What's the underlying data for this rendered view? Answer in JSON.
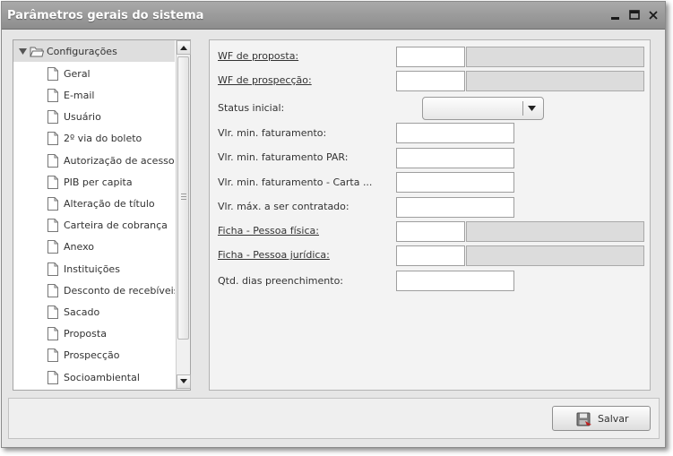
{
  "window": {
    "title": "Parâmetros gerais do sistema",
    "controls": {
      "minimize_icon": "minimize-icon",
      "maximize_icon": "maximize-icon",
      "close_icon": "close-icon"
    }
  },
  "tree": {
    "root_label": "Configurações",
    "items": [
      {
        "label": "Geral"
      },
      {
        "label": "E-mail"
      },
      {
        "label": "Usuário"
      },
      {
        "label": "2º via do boleto"
      },
      {
        "label": "Autorização de acesso"
      },
      {
        "label": "PIB per capita"
      },
      {
        "label": "Alteração de título"
      },
      {
        "label": "Carteira de cobrança"
      },
      {
        "label": "Anexo"
      },
      {
        "label": "Instituições"
      },
      {
        "label": "Desconto de recebíveis"
      },
      {
        "label": "Sacado"
      },
      {
        "label": "Proposta"
      },
      {
        "label": "Prospecção"
      },
      {
        "label": "Socioambiental"
      }
    ]
  },
  "form": {
    "wf_proposta": {
      "label": "WF de proposta:",
      "code": "",
      "desc": ""
    },
    "wf_prospeccao": {
      "label": "WF de prospecção:",
      "code": "",
      "desc": ""
    },
    "status_inicial": {
      "label": "Status inicial:",
      "value": ""
    },
    "vlr_min_faturamento": {
      "label": "Vlr. min. faturamento:",
      "value": ""
    },
    "vlr_min_faturamento_par": {
      "label": "Vlr. min. faturamento PAR:",
      "value": ""
    },
    "vlr_min_faturamento_carta": {
      "label": "Vlr. min. faturamento - Carta ...",
      "value": ""
    },
    "vlr_max_contratado": {
      "label": "Vlr. máx. a ser contratado:",
      "value": ""
    },
    "ficha_pf": {
      "label": "Ficha - Pessoa física:",
      "code": "",
      "desc": ""
    },
    "ficha_pj": {
      "label": "Ficha - Pessoa jurídica:",
      "code": "",
      "desc": ""
    },
    "qtd_dias": {
      "label": "Qtd. dias preenchimento:",
      "value": ""
    }
  },
  "footer": {
    "save_label": "Salvar"
  }
}
